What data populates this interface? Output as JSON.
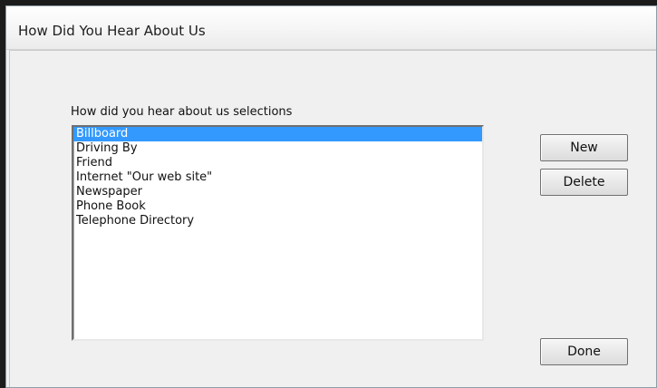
{
  "window": {
    "title": "How Did You Hear About Us"
  },
  "list": {
    "caption": "How did you hear about us selections",
    "selected_index": 0,
    "items": [
      "Billboard",
      "Driving By",
      "Friend",
      "Internet \"Our web site\"",
      "Newspaper",
      "Phone Book",
      "Telephone Directory"
    ]
  },
  "buttons": {
    "new_label": "New",
    "delete_label": "Delete",
    "done_label": "Done"
  },
  "colors": {
    "selection": "#3399ff",
    "dialog_background": "#f0f0f0",
    "frame": "#1c1c1c"
  }
}
